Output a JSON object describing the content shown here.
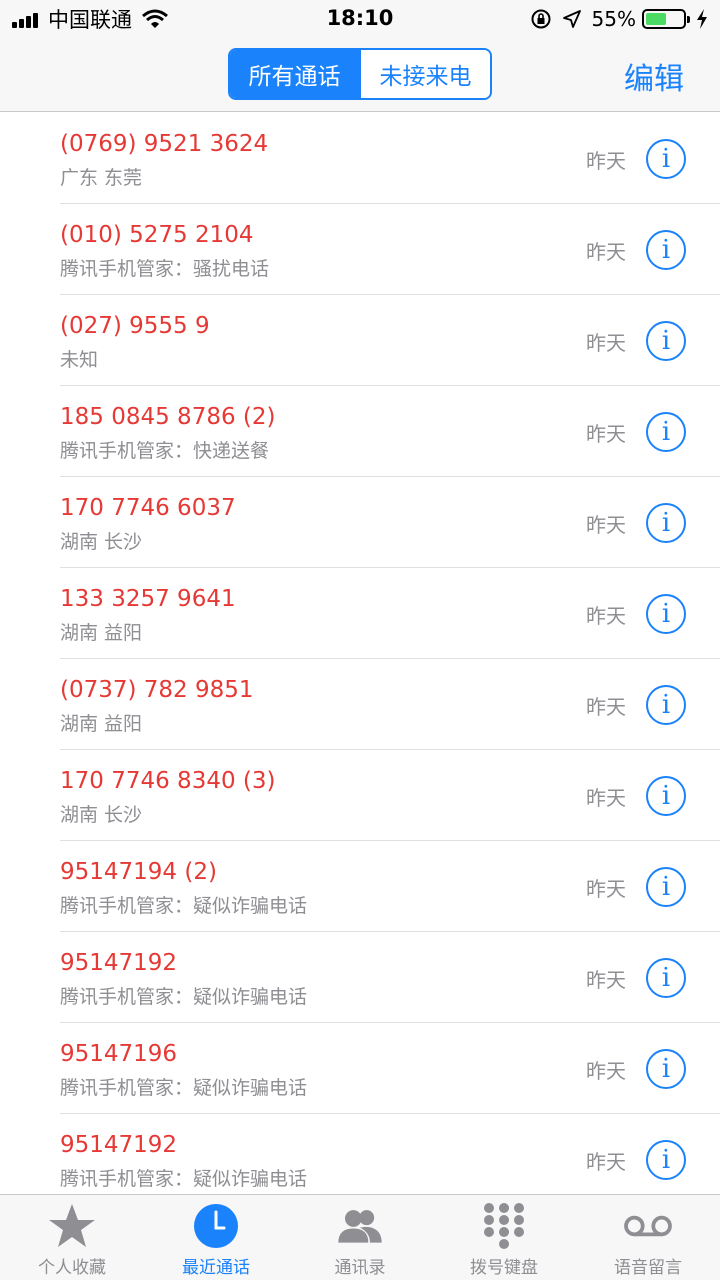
{
  "status_bar": {
    "carrier": "中国联通",
    "time": "18:10",
    "battery": "55%",
    "battery_level": 0.55
  },
  "nav": {
    "segments": [
      {
        "label": "所有通话",
        "active": true
      },
      {
        "label": "未接来电",
        "active": false
      }
    ],
    "edit_label": "编辑"
  },
  "calls": [
    {
      "number": "(0769) 9521 3624",
      "location": "广东 东莞",
      "date": "昨天"
    },
    {
      "number": "(010) 5275 2104",
      "location": "腾讯手机管家：骚扰电话",
      "date": "昨天"
    },
    {
      "number": "(027) 9555 9",
      "location": "未知",
      "date": "昨天"
    },
    {
      "number": "185 0845 8786 (2)",
      "location": "腾讯手机管家：快递送餐",
      "date": "昨天"
    },
    {
      "number": "170 7746 6037",
      "location": "湖南 长沙",
      "date": "昨天"
    },
    {
      "number": "133 3257 9641",
      "location": "湖南 益阳",
      "date": "昨天"
    },
    {
      "number": "(0737) 782 9851",
      "location": "湖南 益阳",
      "date": "昨天"
    },
    {
      "number": "170 7746 8340 (3)",
      "location": "湖南 长沙",
      "date": "昨天"
    },
    {
      "number": "95147194 (2)",
      "location": "腾讯手机管家：疑似诈骗电话",
      "date": "昨天"
    },
    {
      "number": "95147192",
      "location": "腾讯手机管家：疑似诈骗电话",
      "date": "昨天"
    },
    {
      "number": "95147196",
      "location": "腾讯手机管家：疑似诈骗电话",
      "date": "昨天"
    },
    {
      "number": "95147192",
      "location": "腾讯手机管家：疑似诈骗电话",
      "date": "昨天"
    }
  ],
  "info_glyph": "i",
  "tabs": [
    {
      "label": "个人收藏",
      "icon": "star-icon",
      "active": false
    },
    {
      "label": "最近通话",
      "icon": "clock-icon",
      "active": true
    },
    {
      "label": "通讯录",
      "icon": "contacts-icon",
      "active": false
    },
    {
      "label": "拨号键盘",
      "icon": "keypad-icon",
      "active": false
    },
    {
      "label": "语音留言",
      "icon": "voicemail-icon",
      "active": false
    }
  ],
  "colors": {
    "accent": "#1a82fb",
    "missed_call": "#e53935",
    "secondary_text": "#8e8e93",
    "battery_fill": "#4cd964"
  }
}
